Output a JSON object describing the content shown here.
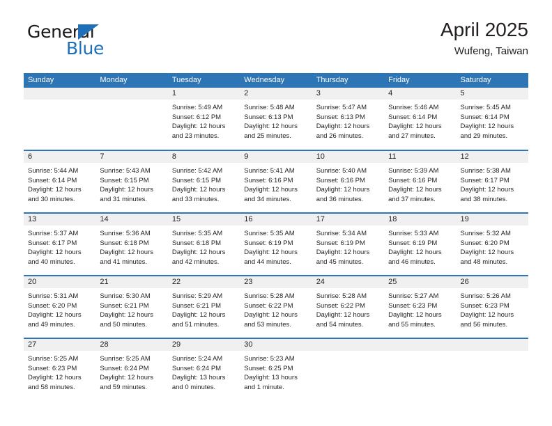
{
  "logo": {
    "word_top": "General",
    "word_bottom": "Blue",
    "triangle_icon": "triangle-icon",
    "accent_color": "#1d6fb8"
  },
  "header": {
    "title": "April 2025",
    "location": "Wufeng, Taiwan"
  },
  "colors": {
    "header_blue": "#2e75b6",
    "daynum_band": "#f0f0f0",
    "text": "#231f20"
  },
  "weekday_headers": [
    "Sunday",
    "Monday",
    "Tuesday",
    "Wednesday",
    "Thursday",
    "Friday",
    "Saturday"
  ],
  "weeks": [
    [
      {
        "day": "",
        "sunrise": "",
        "sunset": "",
        "daylight_line1": "",
        "daylight_line2": ""
      },
      {
        "day": "",
        "sunrise": "",
        "sunset": "",
        "daylight_line1": "",
        "daylight_line2": ""
      },
      {
        "day": "1",
        "sunrise": "Sunrise: 5:49 AM",
        "sunset": "Sunset: 6:12 PM",
        "daylight_line1": "Daylight: 12 hours",
        "daylight_line2": "and 23 minutes."
      },
      {
        "day": "2",
        "sunrise": "Sunrise: 5:48 AM",
        "sunset": "Sunset: 6:13 PM",
        "daylight_line1": "Daylight: 12 hours",
        "daylight_line2": "and 25 minutes."
      },
      {
        "day": "3",
        "sunrise": "Sunrise: 5:47 AM",
        "sunset": "Sunset: 6:13 PM",
        "daylight_line1": "Daylight: 12 hours",
        "daylight_line2": "and 26 minutes."
      },
      {
        "day": "4",
        "sunrise": "Sunrise: 5:46 AM",
        "sunset": "Sunset: 6:14 PM",
        "daylight_line1": "Daylight: 12 hours",
        "daylight_line2": "and 27 minutes."
      },
      {
        "day": "5",
        "sunrise": "Sunrise: 5:45 AM",
        "sunset": "Sunset: 6:14 PM",
        "daylight_line1": "Daylight: 12 hours",
        "daylight_line2": "and 29 minutes."
      }
    ],
    [
      {
        "day": "6",
        "sunrise": "Sunrise: 5:44 AM",
        "sunset": "Sunset: 6:14 PM",
        "daylight_line1": "Daylight: 12 hours",
        "daylight_line2": "and 30 minutes."
      },
      {
        "day": "7",
        "sunrise": "Sunrise: 5:43 AM",
        "sunset": "Sunset: 6:15 PM",
        "daylight_line1": "Daylight: 12 hours",
        "daylight_line2": "and 31 minutes."
      },
      {
        "day": "8",
        "sunrise": "Sunrise: 5:42 AM",
        "sunset": "Sunset: 6:15 PM",
        "daylight_line1": "Daylight: 12 hours",
        "daylight_line2": "and 33 minutes."
      },
      {
        "day": "9",
        "sunrise": "Sunrise: 5:41 AM",
        "sunset": "Sunset: 6:16 PM",
        "daylight_line1": "Daylight: 12 hours",
        "daylight_line2": "and 34 minutes."
      },
      {
        "day": "10",
        "sunrise": "Sunrise: 5:40 AM",
        "sunset": "Sunset: 6:16 PM",
        "daylight_line1": "Daylight: 12 hours",
        "daylight_line2": "and 36 minutes."
      },
      {
        "day": "11",
        "sunrise": "Sunrise: 5:39 AM",
        "sunset": "Sunset: 6:16 PM",
        "daylight_line1": "Daylight: 12 hours",
        "daylight_line2": "and 37 minutes."
      },
      {
        "day": "12",
        "sunrise": "Sunrise: 5:38 AM",
        "sunset": "Sunset: 6:17 PM",
        "daylight_line1": "Daylight: 12 hours",
        "daylight_line2": "and 38 minutes."
      }
    ],
    [
      {
        "day": "13",
        "sunrise": "Sunrise: 5:37 AM",
        "sunset": "Sunset: 6:17 PM",
        "daylight_line1": "Daylight: 12 hours",
        "daylight_line2": "and 40 minutes."
      },
      {
        "day": "14",
        "sunrise": "Sunrise: 5:36 AM",
        "sunset": "Sunset: 6:18 PM",
        "daylight_line1": "Daylight: 12 hours",
        "daylight_line2": "and 41 minutes."
      },
      {
        "day": "15",
        "sunrise": "Sunrise: 5:35 AM",
        "sunset": "Sunset: 6:18 PM",
        "daylight_line1": "Daylight: 12 hours",
        "daylight_line2": "and 42 minutes."
      },
      {
        "day": "16",
        "sunrise": "Sunrise: 5:35 AM",
        "sunset": "Sunset: 6:19 PM",
        "daylight_line1": "Daylight: 12 hours",
        "daylight_line2": "and 44 minutes."
      },
      {
        "day": "17",
        "sunrise": "Sunrise: 5:34 AM",
        "sunset": "Sunset: 6:19 PM",
        "daylight_line1": "Daylight: 12 hours",
        "daylight_line2": "and 45 minutes."
      },
      {
        "day": "18",
        "sunrise": "Sunrise: 5:33 AM",
        "sunset": "Sunset: 6:19 PM",
        "daylight_line1": "Daylight: 12 hours",
        "daylight_line2": "and 46 minutes."
      },
      {
        "day": "19",
        "sunrise": "Sunrise: 5:32 AM",
        "sunset": "Sunset: 6:20 PM",
        "daylight_line1": "Daylight: 12 hours",
        "daylight_line2": "and 48 minutes."
      }
    ],
    [
      {
        "day": "20",
        "sunrise": "Sunrise: 5:31 AM",
        "sunset": "Sunset: 6:20 PM",
        "daylight_line1": "Daylight: 12 hours",
        "daylight_line2": "and 49 minutes."
      },
      {
        "day": "21",
        "sunrise": "Sunrise: 5:30 AM",
        "sunset": "Sunset: 6:21 PM",
        "daylight_line1": "Daylight: 12 hours",
        "daylight_line2": "and 50 minutes."
      },
      {
        "day": "22",
        "sunrise": "Sunrise: 5:29 AM",
        "sunset": "Sunset: 6:21 PM",
        "daylight_line1": "Daylight: 12 hours",
        "daylight_line2": "and 51 minutes."
      },
      {
        "day": "23",
        "sunrise": "Sunrise: 5:28 AM",
        "sunset": "Sunset: 6:22 PM",
        "daylight_line1": "Daylight: 12 hours",
        "daylight_line2": "and 53 minutes."
      },
      {
        "day": "24",
        "sunrise": "Sunrise: 5:28 AM",
        "sunset": "Sunset: 6:22 PM",
        "daylight_line1": "Daylight: 12 hours",
        "daylight_line2": "and 54 minutes."
      },
      {
        "day": "25",
        "sunrise": "Sunrise: 5:27 AM",
        "sunset": "Sunset: 6:23 PM",
        "daylight_line1": "Daylight: 12 hours",
        "daylight_line2": "and 55 minutes."
      },
      {
        "day": "26",
        "sunrise": "Sunrise: 5:26 AM",
        "sunset": "Sunset: 6:23 PM",
        "daylight_line1": "Daylight: 12 hours",
        "daylight_line2": "and 56 minutes."
      }
    ],
    [
      {
        "day": "27",
        "sunrise": "Sunrise: 5:25 AM",
        "sunset": "Sunset: 6:23 PM",
        "daylight_line1": "Daylight: 12 hours",
        "daylight_line2": "and 58 minutes."
      },
      {
        "day": "28",
        "sunrise": "Sunrise: 5:25 AM",
        "sunset": "Sunset: 6:24 PM",
        "daylight_line1": "Daylight: 12 hours",
        "daylight_line2": "and 59 minutes."
      },
      {
        "day": "29",
        "sunrise": "Sunrise: 5:24 AM",
        "sunset": "Sunset: 6:24 PM",
        "daylight_line1": "Daylight: 13 hours",
        "daylight_line2": "and 0 minutes."
      },
      {
        "day": "30",
        "sunrise": "Sunrise: 5:23 AM",
        "sunset": "Sunset: 6:25 PM",
        "daylight_line1": "Daylight: 13 hours",
        "daylight_line2": "and 1 minute."
      },
      {
        "day": "",
        "sunrise": "",
        "sunset": "",
        "daylight_line1": "",
        "daylight_line2": ""
      },
      {
        "day": "",
        "sunrise": "",
        "sunset": "",
        "daylight_line1": "",
        "daylight_line2": ""
      },
      {
        "day": "",
        "sunrise": "",
        "sunset": "",
        "daylight_line1": "",
        "daylight_line2": ""
      }
    ]
  ]
}
